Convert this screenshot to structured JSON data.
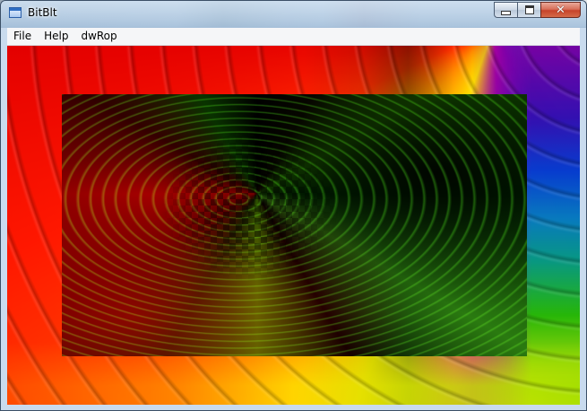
{
  "window": {
    "title": "BitBlt",
    "app_icon": "window-icon",
    "caption_buttons": {
      "minimize_icon": "minimize-icon",
      "maximize_icon": "maximize-icon",
      "close_icon": "close-icon",
      "close_glyph": "✕"
    }
  },
  "menu": {
    "items": [
      {
        "label": "File"
      },
      {
        "label": "Help"
      },
      {
        "label": "dwRop"
      }
    ]
  },
  "client": {
    "background_image": "rainbow-swirl",
    "blit_region": "inverted-swirl-overlay"
  },
  "colors": {
    "close_button": "#c7432a",
    "menubar": "#f5f6f8"
  }
}
